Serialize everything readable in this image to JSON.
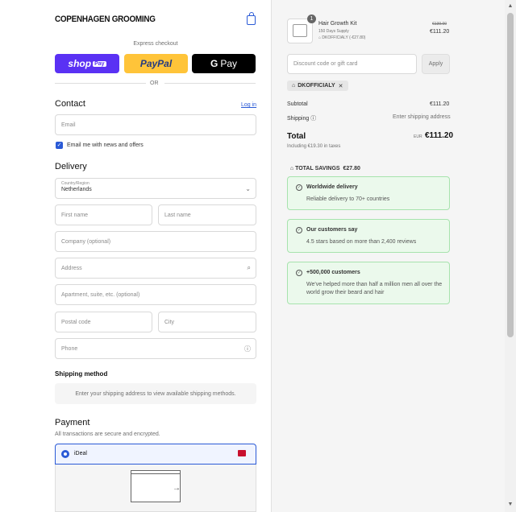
{
  "header": {
    "logo": "COPENHAGEN GROOMING"
  },
  "express": {
    "title": "Express checkout",
    "shop_pay": "shop",
    "shop_pay_badge": "Pay",
    "paypal": "PayPal",
    "gpay": "Pay",
    "gpay_g": "G",
    "or": "OR"
  },
  "contact": {
    "title": "Contact",
    "login": "Log in",
    "email_placeholder": "Email",
    "newsletter": "Email me with news and offers"
  },
  "delivery": {
    "title": "Delivery",
    "country_label": "Country/Region",
    "country_value": "Netherlands",
    "first_name": "First name",
    "last_name": "Last name",
    "company": "Company (optional)",
    "address": "Address",
    "apartment": "Apartment, suite, etc. (optional)",
    "postal": "Postal code",
    "city": "City",
    "phone": "Phone"
  },
  "shipping_method": {
    "title": "Shipping method",
    "message": "Enter your shipping address to view available shipping methods."
  },
  "payment": {
    "title": "Payment",
    "subtitle": "All transactions are secure and encrypted.",
    "ideal": "iDeal"
  },
  "summary": {
    "product": {
      "name": "Hair Growth Kit",
      "variant": "150 Days Supply",
      "discount": "DKOFFICIALY (-€27.80)",
      "old_price": "€139.00",
      "price": "€111.20",
      "quantity": "1"
    },
    "discount_placeholder": "Discount code or gift card",
    "apply": "Apply",
    "applied_code": "DKOFFICIALY",
    "subtotal_label": "Subtotal",
    "subtotal_value": "€111.20",
    "shipping_label": "Shipping",
    "shipping_value": "Enter shipping address",
    "total_label": "Total",
    "currency": "EUR",
    "total_value": "€111.20",
    "taxes": "Including €19.30 in taxes",
    "savings": "TOTAL SAVINGS  €27.80"
  },
  "benefits": [
    {
      "title": "Worldwide delivery",
      "desc": "Reliable delivery to 70+ countries"
    },
    {
      "title": "Our customers say",
      "desc": "4.5 stars based on more than 2,400 reviews"
    },
    {
      "title": "+500,000 customers",
      "desc": "We've helped more than half a million men all over the world grow their beard and hair"
    }
  ]
}
